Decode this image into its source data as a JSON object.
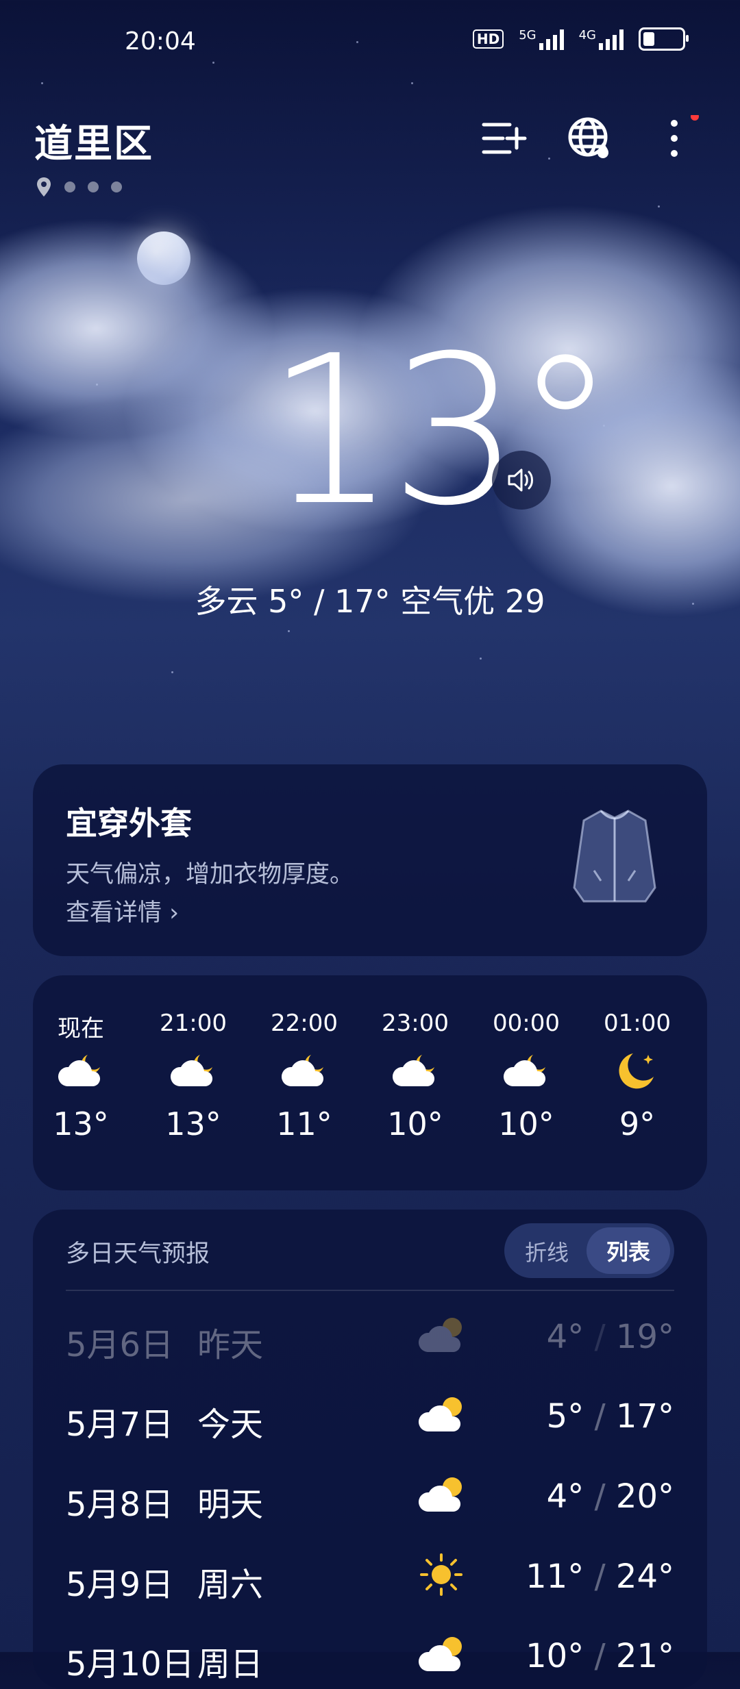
{
  "status_bar": {
    "time": "20:04",
    "hd": "HD",
    "net1": "5G",
    "net2": "4G"
  },
  "header": {
    "city": "道里区"
  },
  "current": {
    "temperature": "13°",
    "summary": "多云  5° / 17°  空气优 29"
  },
  "clothing_card": {
    "title": "宜穿外套",
    "subtitle": "天气偏凉，增加衣物厚度。",
    "link": "查看详情 ›"
  },
  "hourly": [
    {
      "time": "现在",
      "temp": "13°",
      "icon": "partly-cloudy-night-icon"
    },
    {
      "time": "21:00",
      "temp": "13°",
      "icon": "partly-cloudy-night-icon"
    },
    {
      "time": "22:00",
      "temp": "11°",
      "icon": "partly-cloudy-night-icon"
    },
    {
      "time": "23:00",
      "temp": "10°",
      "icon": "partly-cloudy-night-icon"
    },
    {
      "time": "00:00",
      "temp": "10°",
      "icon": "partly-cloudy-night-icon"
    },
    {
      "time": "01:00",
      "temp": "9°",
      "icon": "clear-night-moon-icon"
    }
  ],
  "forecast": {
    "title": "多日天气预报",
    "toggle_left": "折线",
    "toggle_right": "列表",
    "days": [
      {
        "date": "5月6日",
        "rel": "昨天",
        "low": "4°",
        "high": "19°",
        "icon": "cloudy-icon"
      },
      {
        "date": "5月7日",
        "rel": "今天",
        "low": "5°",
        "high": "17°",
        "icon": "partly-cloudy-day-icon"
      },
      {
        "date": "5月8日",
        "rel": "明天",
        "low": "4°",
        "high": "20°",
        "icon": "partly-cloudy-day-icon"
      },
      {
        "date": "5月9日",
        "rel": "周六",
        "low": "11°",
        "high": "24°",
        "icon": "sunny-icon"
      },
      {
        "date": "5月10日",
        "rel": "周日",
        "low": "10°",
        "high": "21°",
        "icon": "partly-cloudy-day-icon"
      }
    ]
  },
  "colors": {
    "accent_sun": "#f7c12e",
    "badge_red": "#ff3b3b"
  }
}
